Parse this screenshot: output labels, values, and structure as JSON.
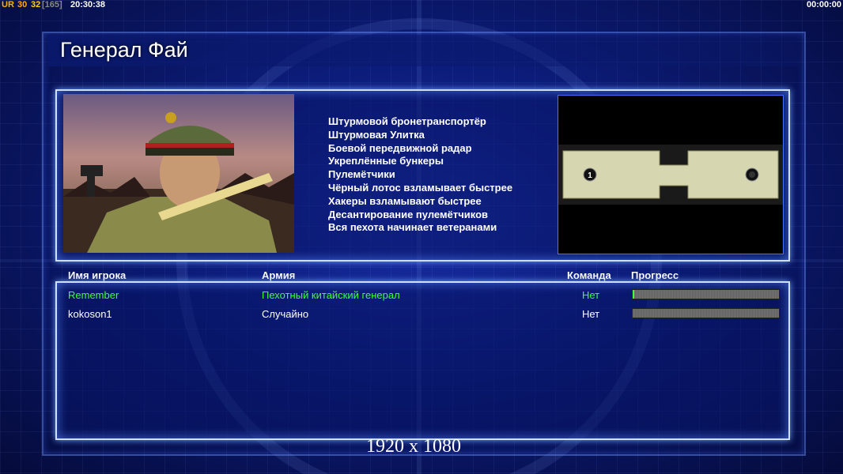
{
  "topbar": {
    "ur_label": "UR",
    "fps1": "30",
    "fps2": "32",
    "bracket": "[165]",
    "clock": "20:30:38",
    "timer": "00:00:00"
  },
  "general": {
    "title": "Генерал Фай"
  },
  "features": [
    "Штурмовой бронетранспортёр",
    "Штурмовая Улитка",
    "Боевой передвижной радар",
    "Укреплённые бункеры",
    "Пулемётчики",
    "Чёрный лотос взламывает быстрее",
    "Хакеры взламывают быстрее",
    "Десантирование пулемётчиков",
    "Вся пехота начинает ветеранами"
  ],
  "map": {
    "start_marker": "1"
  },
  "columns": {
    "player": "Имя игрока",
    "army": "Армия",
    "team": "Команда",
    "progress": "Прогресс"
  },
  "players": [
    {
      "name": "Remember",
      "army": "Пехотный китайский генерал",
      "team": "Нет",
      "progress": 0.01,
      "color": "#3dff3d"
    },
    {
      "name": "kokoson1",
      "army": "Случайно",
      "team": "Нет",
      "progress": 0.0,
      "color": "#ffffff"
    }
  ],
  "resolution_label": "1920 x 1080",
  "colors": {
    "accent_panel_border": "#cfe0ff",
    "local_player": "#3dff3d",
    "progress_fill": "#3cff3c"
  }
}
